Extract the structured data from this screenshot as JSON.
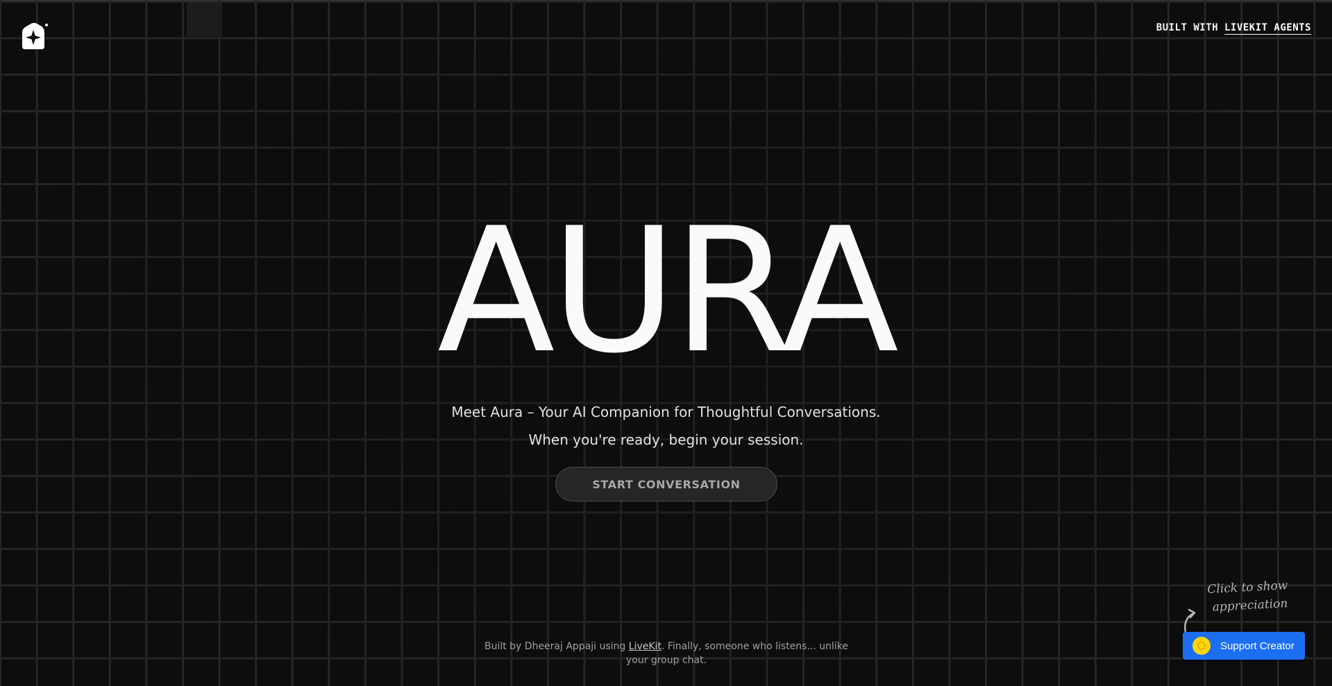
{
  "header": {
    "logo_icon": "sparkle-house-icon",
    "nav_prefix": "BUILT WITH ",
    "nav_link": "LIVEKIT AGENTS"
  },
  "hero": {
    "title": "AURA",
    "tagline_line1": "Meet Aura – Your AI Companion for Thoughtful Conversations.",
    "tagline_line2": "When you're ready, begin your session.",
    "start_button": "START CONVERSATION"
  },
  "footer": {
    "text_before": "Built by Dheeraj Appaji using ",
    "link": "LiveKit",
    "text_after": ". Finally, someone who listens... unlike your group chat."
  },
  "support": {
    "hint_line1": "Click to show",
    "hint_line2": "appreciation",
    "button_label": "Support Creator",
    "button_color": "#1d6ff2",
    "coin_color": "#ffd60a"
  },
  "colors": {
    "background": "#0d0d0d",
    "grid_line": "#262626",
    "text": "#f5f5f5"
  }
}
